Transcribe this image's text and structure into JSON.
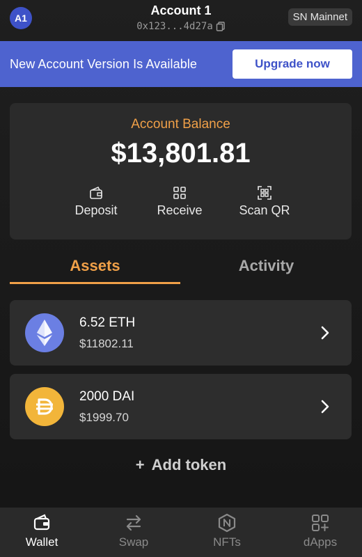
{
  "header": {
    "avatar_initials": "A1",
    "account_name": "Account 1",
    "account_address": "0x123...4d27a",
    "network": "SN Mainnet"
  },
  "banner": {
    "message": "New Account Version Is Available",
    "button_label": "Upgrade now"
  },
  "balance": {
    "label": "Account Balance",
    "value": "$13,801.81",
    "actions": [
      {
        "label": "Deposit",
        "icon": "wallet-icon"
      },
      {
        "label": "Receive",
        "icon": "qr-grid-icon"
      },
      {
        "label": "Scan QR",
        "icon": "scan-qr-icon"
      }
    ]
  },
  "tabs": [
    {
      "label": "Assets",
      "active": true
    },
    {
      "label": "Activity",
      "active": false
    }
  ],
  "assets": [
    {
      "amount": "6.52 ETH",
      "value": "$11802.11",
      "icon": "eth-icon",
      "color": "#6b7fe3"
    },
    {
      "amount": "2000 DAI",
      "value": "$1999.70",
      "icon": "dai-icon",
      "color": "#f2b53a"
    }
  ],
  "add_token_label": "Add token",
  "bottom_nav": [
    {
      "label": "Wallet",
      "icon": "wallet-icon",
      "active": true
    },
    {
      "label": "Swap",
      "icon": "swap-arrows-icon",
      "active": false
    },
    {
      "label": "NFTs",
      "icon": "nft-hexagon-icon",
      "active": false
    },
    {
      "label": "dApps",
      "icon": "apps-grid-icon",
      "active": false
    }
  ],
  "colors": {
    "accent": "#f0a048",
    "banner": "#4e63cf",
    "card": "#2b2b2b"
  }
}
